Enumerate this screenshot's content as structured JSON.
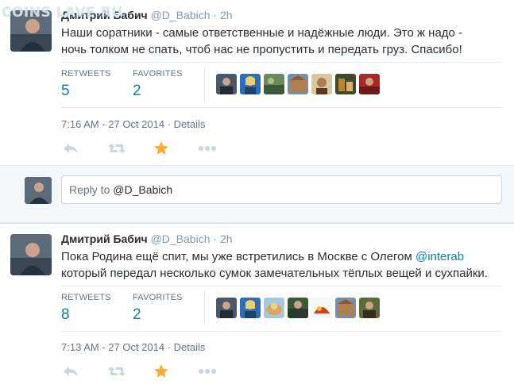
{
  "watermark": "COINS LAVE RU",
  "tweets": [
    {
      "fullname": "Дмитрий Бабич",
      "username": "@D_Babich",
      "dot": "·",
      "time": "2h",
      "text_line1": "Наши соратники - самые ответственные и надёжные люди. Это ж надо -",
      "text_line2": "ночь толком не спать, чтоб нас не пропустить и передать груз. Спасибо!",
      "retweets_label": "RETWEETS",
      "retweets_count": "5",
      "favorites_label": "FAVORITES",
      "favorites_count": "2",
      "timestamp": "7:16 AM - 27 Oct 2014",
      "meta_sep": "·",
      "details_label": "Details",
      "favoriters": [
        "avatar-1",
        "avatar-2",
        "avatar-3",
        "avatar-4",
        "avatar-5",
        "avatar-6",
        "avatar-7"
      ]
    },
    {
      "fullname": "Дмитрий Бабич",
      "username": "@D_Babich",
      "dot": "·",
      "time": "2h",
      "text_line1_prefix": "Пока Родина ещё спит, мы уже встретились в Москве с Олегом ",
      "text_line1_mention": "@interab",
      "text_line2": "который передал несколько сумок замечательных тёплых вещей и сухпайки.",
      "retweets_label": "RETWEETS",
      "retweets_count": "8",
      "favorites_label": "FAVORITES",
      "favorites_count": "2",
      "timestamp": "7:13 AM - 27 Oct 2014",
      "meta_sep": "·",
      "details_label": "Details",
      "favoriters": [
        "avatar-1",
        "avatar-2",
        "avatar-3",
        "avatar-4",
        "avatar-5",
        "avatar-6",
        "avatar-7"
      ]
    }
  ],
  "reply": {
    "prefix": "Reply to ",
    "mention": "@D_Babich"
  },
  "colors": {
    "link": "#0084b4",
    "favorite_star": "#ffac33",
    "muted": "#8899a6"
  },
  "icons": [
    "reply-icon",
    "retweet-icon",
    "favorite-star-icon",
    "more-icon"
  ]
}
